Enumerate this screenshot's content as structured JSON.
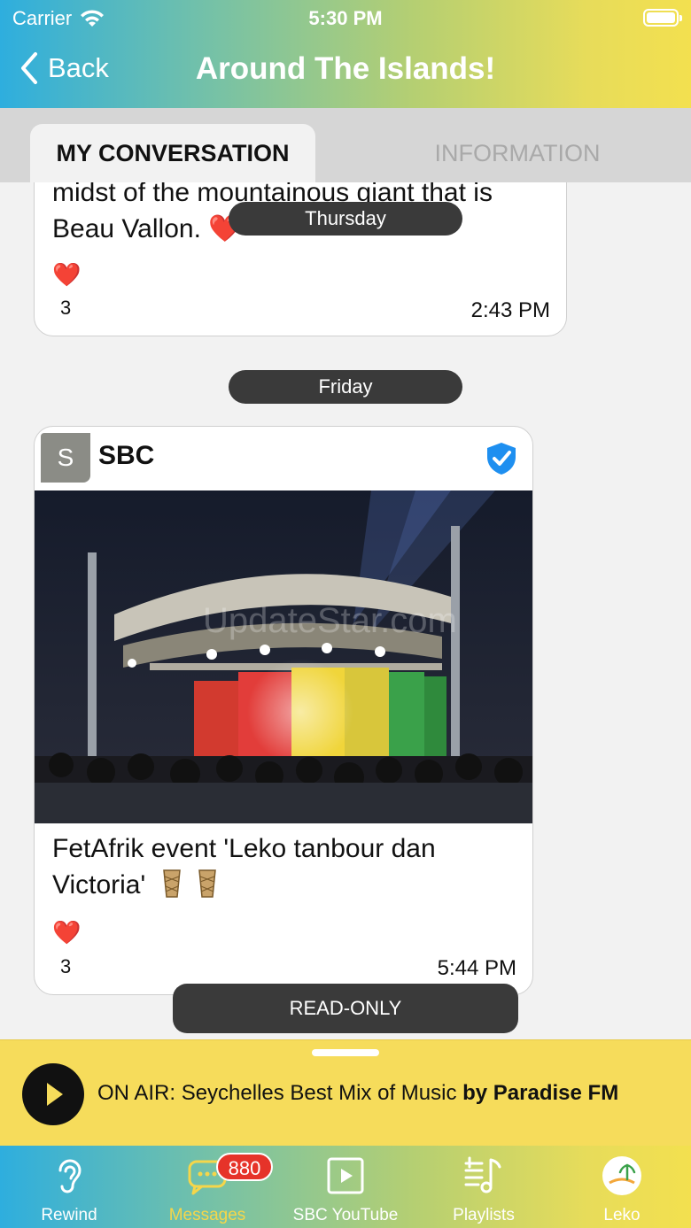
{
  "status_bar": {
    "carrier": "Carrier",
    "time": "5:30 PM"
  },
  "header": {
    "back_label": "Back",
    "title": "Around The Islands!"
  },
  "tabs": [
    {
      "label": "MY CONVERSATION",
      "active": true
    },
    {
      "label": "INFORMATION",
      "active": false
    }
  ],
  "messages": [
    {
      "text": "midst of the mountainous giant that is Beau Vallon. ❤️",
      "reaction": "❤️",
      "reaction_count": "3",
      "time": "2:43 PM"
    },
    {
      "sender_initial": "S",
      "sender": "SBC",
      "verified": true,
      "image_watermark": "UpdateStar.com",
      "caption": "FetAfrik event 'Leko tanbour dan Victoria'",
      "reaction": "❤️",
      "reaction_count": "3",
      "time": "5:44 PM"
    }
  ],
  "day_separators": [
    "Thursday",
    "Friday"
  ],
  "read_only_label": "READ-ONLY",
  "player": {
    "prefix": "ON AIR: Seychelles Best Mix of Music ",
    "station": "by Paradise FM"
  },
  "tabbar": {
    "items": [
      {
        "label": "Rewind",
        "icon": "ear-icon"
      },
      {
        "label": "Messages",
        "icon": "chat-icon",
        "badge": "880",
        "active": true
      },
      {
        "label": "SBC YouTube",
        "icon": "video-play-icon"
      },
      {
        "label": "Playlists",
        "icon": "playlist-icon"
      },
      {
        "label": "Leko",
        "icon": "leko-logo-icon"
      }
    ]
  },
  "colors": {
    "header_gradient_start": "#2eaede",
    "header_gradient_end": "#f3e04f",
    "player_bg": "#f6dc5b",
    "verified_blue": "#1e8ff0",
    "badge_red": "#e63329",
    "pill_dark": "#3a3a3a"
  }
}
